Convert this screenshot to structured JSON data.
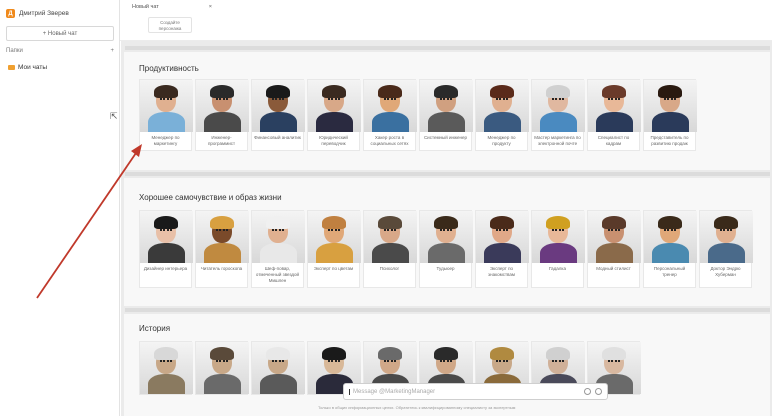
{
  "sidebar": {
    "user_name": "Дмитрий Зверев",
    "user_initial": "Д",
    "new_chat": "+ Новый чат",
    "folders_label": "Папки",
    "folders_add": "+",
    "my_chats": "Мои чаты"
  },
  "tabs": [
    {
      "label": "Новый чат",
      "close": "×"
    }
  ],
  "create_character": "Создайте персонажа",
  "sections": {
    "productivity": {
      "title": "Продуктивность",
      "cards": [
        {
          "label": "Менеджер по маркетингу",
          "colors": [
            "#7ab0d8",
            "#3a2a20",
            "#e0b090"
          ]
        },
        {
          "label": "Инженер-программист",
          "colors": [
            "#4a4a4a",
            "#2a2a2a",
            "#c89070"
          ]
        },
        {
          "label": "Финансовый аналитик",
          "colors": [
            "#2a4060",
            "#1a1a1a",
            "#8a5a3a"
          ]
        },
        {
          "label": "Юридический переводчик",
          "colors": [
            "#2a2a40",
            "#3a2a20",
            "#d8a888"
          ]
        },
        {
          "label": "Хакер роста в социальных сетях",
          "colors": [
            "#3a70a0",
            "#4a2a1a",
            "#e0a878"
          ]
        },
        {
          "label": "Системный инженер",
          "colors": [
            "#5a5a5a",
            "#2a2a2a",
            "#d0a080"
          ]
        },
        {
          "label": "Менеджер по продукту",
          "colors": [
            "#3a5a80",
            "#5a2a1a",
            "#e0b090"
          ]
        },
        {
          "label": "Мастер маркетинга по электронной почте",
          "colors": [
            "#4a8ac0",
            "#d0d0d0",
            "#e0b8a0"
          ]
        },
        {
          "label": "Специалист по кадрам",
          "colors": [
            "#2a3a5a",
            "#6a3a2a",
            "#e8b898"
          ]
        },
        {
          "label": "Представитель по развитию продаж",
          "colors": [
            "#2a3a5a",
            "#2a1a10",
            "#d8a888"
          ]
        }
      ]
    },
    "wellbeing": {
      "title": "Хорошее самочувствие и образ жизни",
      "cards": [
        {
          "label": "Дизайнер интерьера",
          "colors": [
            "#3a3a3a",
            "#1a1a1a",
            "#e8c0a8"
          ]
        },
        {
          "label": "Читатель гороскопа",
          "colors": [
            "#c08a40",
            "#d8a040",
            "#7a4a2a"
          ]
        },
        {
          "label": "Шеф-повар, отмеченный звездой Мишлен",
          "colors": [
            "#e8e8e8",
            "#f0f0f0",
            "#e0b090"
          ]
        },
        {
          "label": "Эксперт по цветам",
          "colors": [
            "#d8a040",
            "#c08040",
            "#e0a878"
          ]
        },
        {
          "label": "Психолог",
          "colors": [
            "#4a4a4a",
            "#5a4a3a",
            "#d8a888"
          ]
        },
        {
          "label": "Тудьюер",
          "colors": [
            "#6a6a6a",
            "#3a2a1a",
            "#e0b090"
          ]
        },
        {
          "label": "Эксперт по знакомствам",
          "colors": [
            "#3a3a5a",
            "#4a2a1a",
            "#e0a888"
          ]
        },
        {
          "label": "Гадалка",
          "colors": [
            "#6a3a80",
            "#d0a020",
            "#e8b898"
          ]
        },
        {
          "label": "Модный стилист",
          "colors": [
            "#8a6a4a",
            "#5a3a2a",
            "#c89070"
          ]
        },
        {
          "label": "Персональный тренер",
          "colors": [
            "#4a8ab0",
            "#3a2a1a",
            "#e0a878"
          ]
        },
        {
          "label": "Доктор Эндрю Хуберман",
          "colors": [
            "#4a6a8a",
            "#3a2a1a",
            "#e0b090"
          ]
        }
      ]
    },
    "history": {
      "title": "История",
      "cards": [
        {
          "colors": [
            "#8a7a60",
            "#d8d8d8",
            "#c8a888"
          ]
        },
        {
          "colors": [
            "#6a6a6a",
            "#5a4a3a",
            "#c8a888"
          ]
        },
        {
          "colors": [
            "#5a5a5a",
            "#e8e8e8",
            "#c8a888"
          ]
        },
        {
          "colors": [
            "#2a2a3a",
            "#1a1a1a",
            "#d8b898"
          ]
        },
        {
          "colors": [
            "#4a4a4a",
            "#6a6a6a",
            "#d0a888"
          ]
        },
        {
          "colors": [
            "#4a4a4a",
            "#2a2a2a",
            "#d0a888"
          ]
        },
        {
          "colors": [
            "#8a6a3a",
            "#b08a40",
            "#c8a888"
          ]
        },
        {
          "colors": [
            "#4a4a5a",
            "#d0d0d0",
            "#d0b098"
          ]
        },
        {
          "colors": [
            "#6a6a6a",
            "#e0e0e0",
            "#d8b8a0"
          ]
        }
      ]
    }
  },
  "chat_input": {
    "placeholder": "Message @MarketingManager"
  },
  "footer": "Только в общих информационных целях. Обратитесь к квалифицированному специалисту за экспертным"
}
